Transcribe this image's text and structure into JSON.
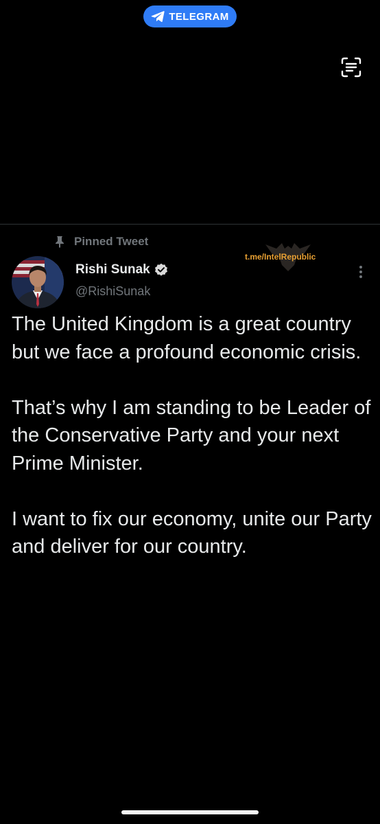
{
  "banner": {
    "label": "TELEGRAM",
    "icon": "telegram-plane-icon",
    "color": "#2f7cf6"
  },
  "toolbar": {
    "scan_icon": "text-scan-icon"
  },
  "tweet": {
    "pinned_label": "Pinned Tweet",
    "author_name": "Rishi Sunak",
    "author_handle": "@RishiSunak",
    "verified": true,
    "paragraphs": [
      "The United Kingdom is a great country but we face a profound economic crisis.",
      "That’s why I am standing to be Leader of the Conservative Party and your next Prime Minister.",
      "I want to fix our economy, unite our Party and deliver for our country."
    ]
  },
  "watermark": {
    "text": "t.me/IntelRepublic",
    "color": "#e8a033"
  }
}
